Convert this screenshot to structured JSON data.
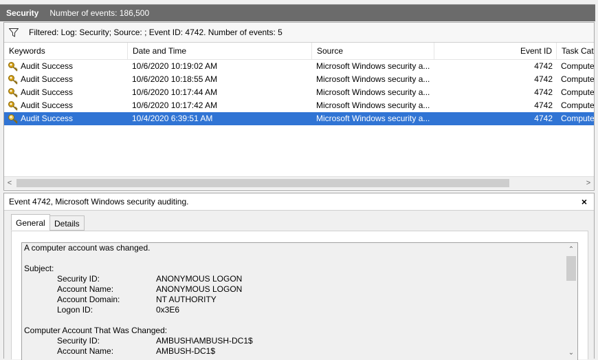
{
  "header": {
    "log_name": "Security",
    "event_count": "Number of events: 186,500"
  },
  "filter": {
    "text": "Filtered: Log: Security; Source: ; Event ID: 4742. Number of events: 5"
  },
  "columns": {
    "keywords": "Keywords",
    "date_time": "Date and Time",
    "source": "Source",
    "event_id": "Event ID",
    "task_category": "Task Cate"
  },
  "rows": [
    {
      "keywords": "Audit Success",
      "date_time": "10/6/2020 10:19:02 AM",
      "source": "Microsoft Windows security a...",
      "event_id": "4742",
      "task_category": "Compute",
      "selected": false
    },
    {
      "keywords": "Audit Success",
      "date_time": "10/6/2020 10:18:55 AM",
      "source": "Microsoft Windows security a...",
      "event_id": "4742",
      "task_category": "Compute",
      "selected": false
    },
    {
      "keywords": "Audit Success",
      "date_time": "10/6/2020 10:17:44 AM",
      "source": "Microsoft Windows security a...",
      "event_id": "4742",
      "task_category": "Compute",
      "selected": false
    },
    {
      "keywords": "Audit Success",
      "date_time": "10/6/2020 10:17:42 AM",
      "source": "Microsoft Windows security a...",
      "event_id": "4742",
      "task_category": "Compute",
      "selected": false
    },
    {
      "keywords": "Audit Success",
      "date_time": "10/4/2020 6:39:51 AM",
      "source": "Microsoft Windows security a...",
      "event_id": "4742",
      "task_category": "Compute",
      "selected": true
    }
  ],
  "detail": {
    "title": "Event 4742, Microsoft Windows security auditing.",
    "close": "×",
    "tabs": {
      "general": "General",
      "details": "Details"
    },
    "description": "A computer account was changed.",
    "subject_heading": "Subject:",
    "subject": {
      "security_id_label": "Security ID:",
      "security_id": "ANONYMOUS LOGON",
      "account_name_label": "Account Name:",
      "account_name": "ANONYMOUS LOGON",
      "account_domain_label": "Account Domain:",
      "account_domain": "NT AUTHORITY",
      "logon_id_label": "Logon ID:",
      "logon_id": "0x3E6"
    },
    "changed_heading": "Computer Account That Was Changed:",
    "changed": {
      "security_id_label": "Security ID:",
      "security_id": "AMBUSH\\AMBUSH-DC1$",
      "account_name_label": "Account Name:",
      "account_name": "AMBUSH-DC1$"
    }
  },
  "colors": {
    "selection": "#3074d4",
    "title_bar": "#6b6b6b",
    "key_icon": "#d4a017"
  },
  "icons": {
    "filter": "funnel-icon",
    "row": "key-icon"
  }
}
